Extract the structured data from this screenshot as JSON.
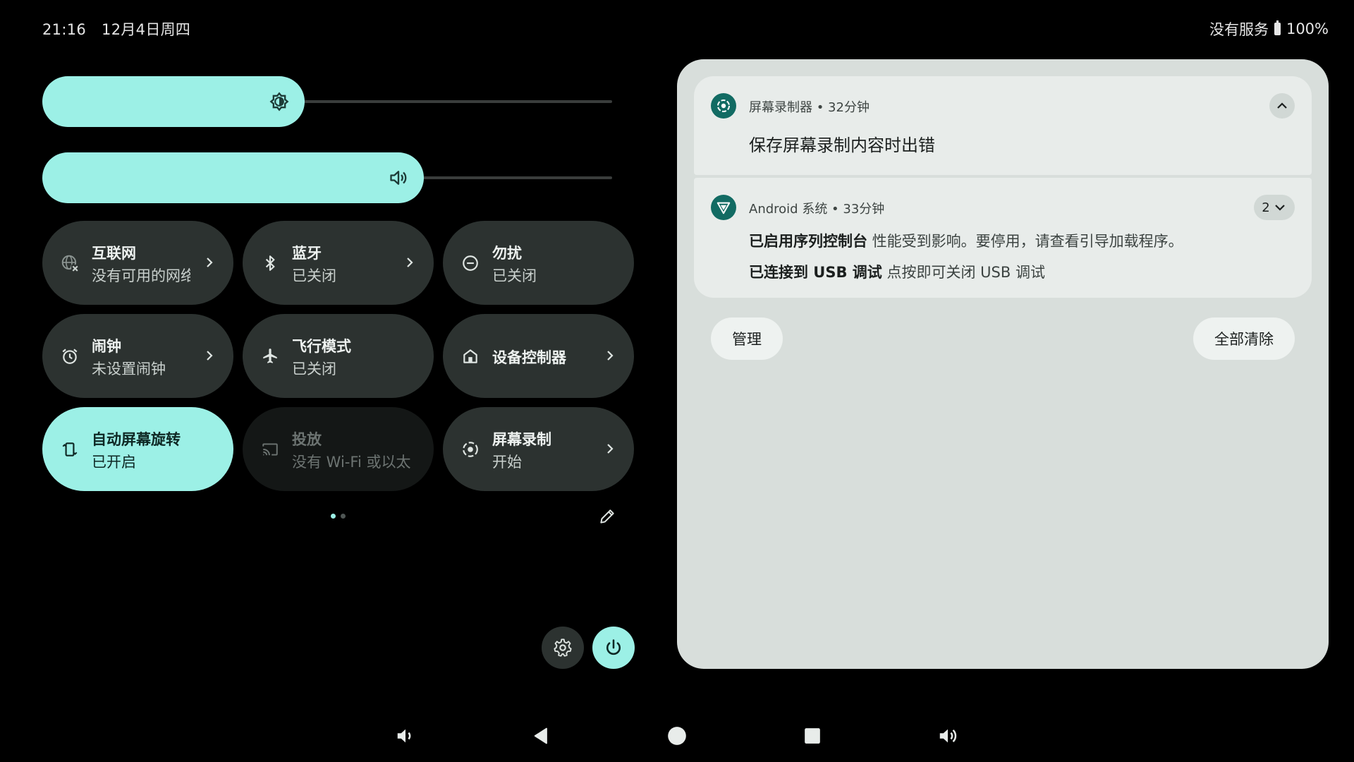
{
  "status_bar": {
    "time": "21:16",
    "date": "12月4日周四",
    "network": "没有服务",
    "battery": "100%"
  },
  "sliders": {
    "brightness": {
      "level": 0.46,
      "icon": "brightness-icon"
    },
    "volume": {
      "level": 0.67,
      "icon": "volume-icon"
    }
  },
  "tiles": [
    {
      "title": "互联网",
      "subtitle": "没有可用的网络",
      "icon": "internet-off-icon",
      "state": "inactive",
      "chevron": true
    },
    {
      "title": "蓝牙",
      "subtitle": "已关闭",
      "icon": "bluetooth-icon",
      "state": "inactive",
      "chevron": true
    },
    {
      "title": "勿扰",
      "subtitle": "已关闭",
      "icon": "do-not-disturb-icon",
      "state": "inactive",
      "chevron": false
    },
    {
      "title": "闹钟",
      "subtitle": "未设置闹钟",
      "icon": "alarm-icon",
      "state": "inactive",
      "chevron": true
    },
    {
      "title": "飞行模式",
      "subtitle": "已关闭",
      "icon": "airplane-icon",
      "state": "inactive",
      "chevron": false
    },
    {
      "title": "设备控制器",
      "subtitle": "",
      "icon": "home-icon",
      "state": "inactive",
      "chevron": true
    },
    {
      "title": "自动屏幕旋转",
      "subtitle": "已开启",
      "icon": "rotate-icon",
      "state": "active",
      "chevron": false
    },
    {
      "title": "投放",
      "subtitle": "没有 Wi-Fi 或以太网",
      "icon": "cast-icon",
      "state": "disabled",
      "chevron": false
    },
    {
      "title": "屏幕录制",
      "subtitle": "开始",
      "icon": "screen-record-icon",
      "state": "inactive",
      "chevron": true
    }
  ],
  "pager": {
    "pages": 2,
    "current": 1
  },
  "notifications": [
    {
      "app": "屏幕录制器",
      "time": "32分钟",
      "header": "屏幕录制器 • 32分钟",
      "title": "保存屏幕录制内容时出错",
      "icon": "screen-record-icon"
    },
    {
      "app": "Android 系统",
      "time": "33分钟",
      "header": "Android 系统 • 33分钟",
      "count": "2",
      "icon": "android-system-icon",
      "lines": [
        {
          "bold": "已启用序列控制台",
          "text": "性能受到影响。要停用，请查看引导加载程序。"
        },
        {
          "bold": "已连接到 USB 调试",
          "text": "点按即可关闭 USB 调试"
        }
      ]
    }
  ],
  "notif_actions": {
    "manage": "管理",
    "clear_all": "全部清除"
  },
  "colors": {
    "accent": "#9cf0e6",
    "tile": "#2c3230",
    "panel": "#d8dedb",
    "card": "#e8ecea",
    "app_icon": "#126b63"
  }
}
